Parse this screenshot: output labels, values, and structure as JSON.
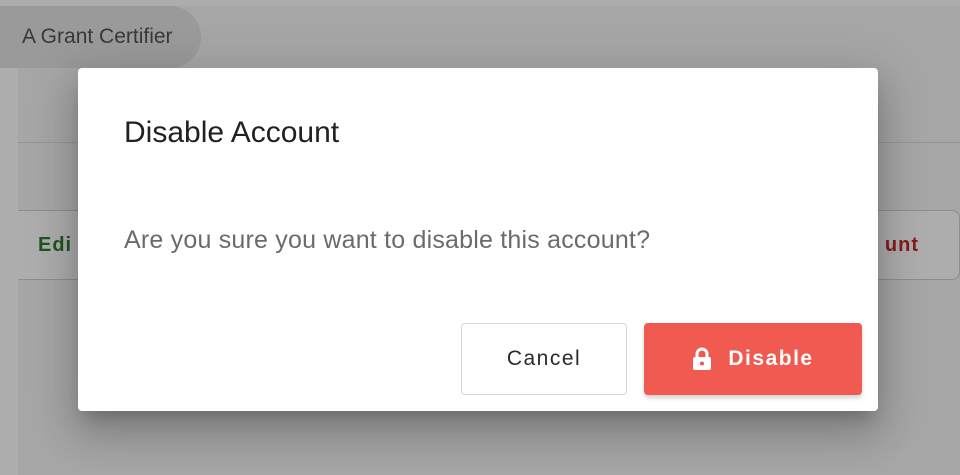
{
  "background": {
    "chip_label": "A Grant Certifier",
    "edit_label": "Edi",
    "disable_account_label": "unt"
  },
  "dialog": {
    "title": "Disable Account",
    "message": "Are you sure you want to disable this account?",
    "cancel_label": "Cancel",
    "disable_label": "Disable",
    "disable_icon": "lock-icon"
  },
  "colors": {
    "overlay": "#000000",
    "disable_button": "#f05a50",
    "edit_text": "#2e7d32",
    "danger_text": "#c62828"
  }
}
